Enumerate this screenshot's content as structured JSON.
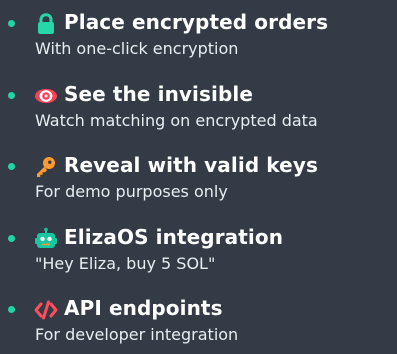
{
  "features": [
    {
      "icon": "lock-icon",
      "title": "Place encrypted orders",
      "subtitle": "With one-click encryption"
    },
    {
      "icon": "eye-icon",
      "title": "See the invisible",
      "subtitle": "Watch matching on encrypted data"
    },
    {
      "icon": "key-icon",
      "title": "Reveal with valid keys",
      "subtitle": "For demo purposes only"
    },
    {
      "icon": "robot-icon",
      "title": "ElizaOS integration",
      "subtitle": "\"Hey Eliza, buy 5 SOL\""
    },
    {
      "icon": "code-icon",
      "title": "API endpoints",
      "subtitle": "For developer integration"
    }
  ],
  "colors": {
    "background": "#343b46",
    "accent": "#21d4a6",
    "lock": "#25d7a9",
    "key": "#ff9a2e",
    "robot": "#16c7a0",
    "code": "#ff4d5a",
    "text": "#ffffff"
  }
}
